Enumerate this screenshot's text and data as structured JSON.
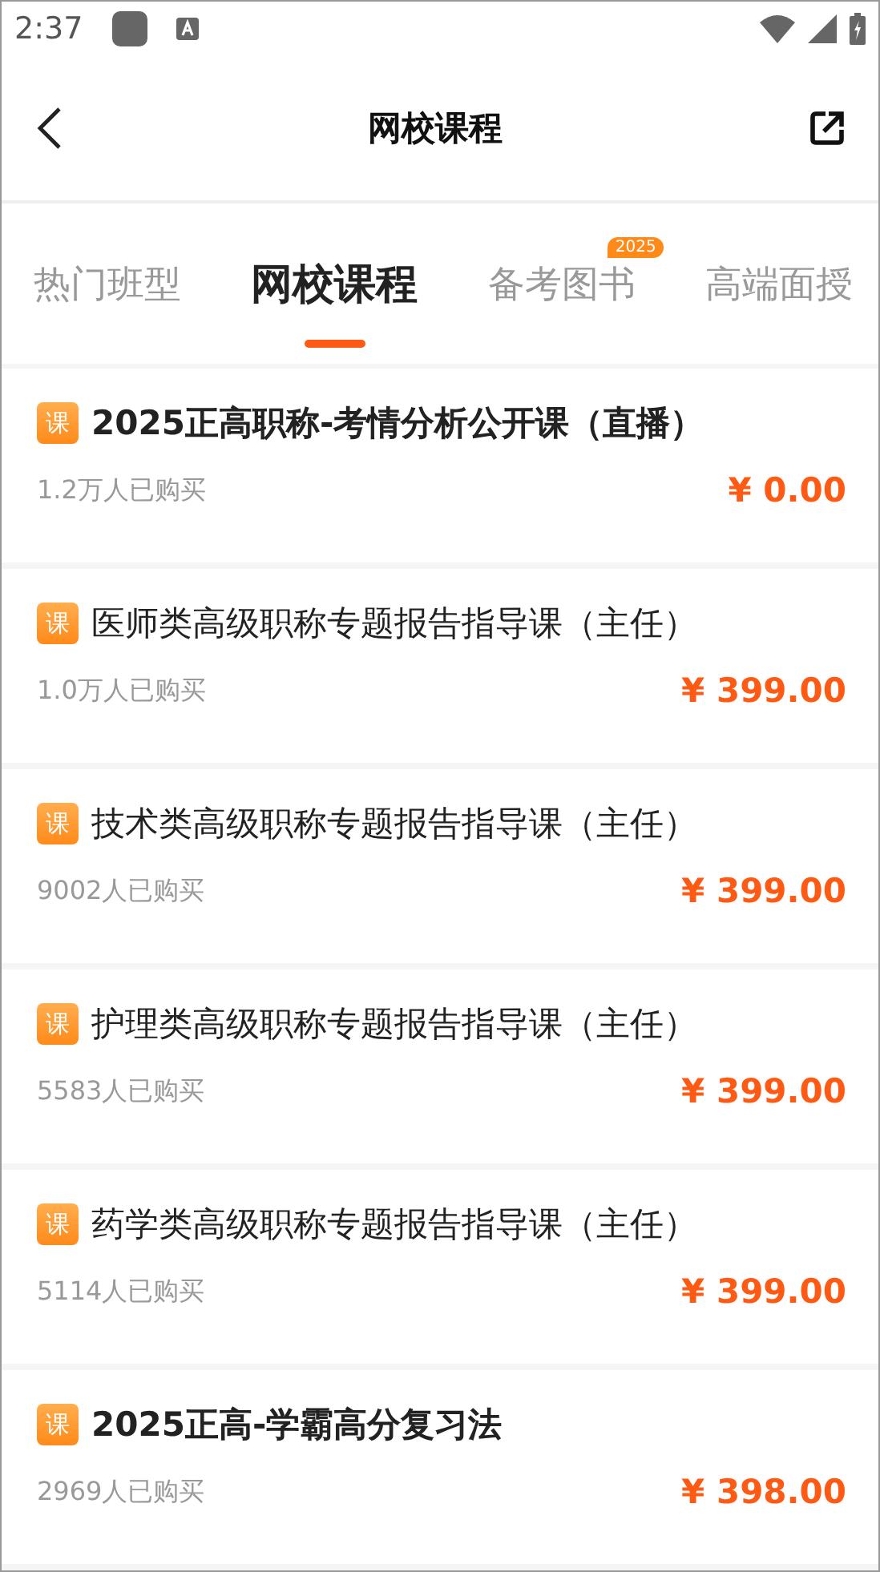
{
  "status_bar": {
    "time": "2:37"
  },
  "header": {
    "title": "网校课程"
  },
  "tabs": [
    {
      "label": "热门班型",
      "selected": false
    },
    {
      "label": "网校课程",
      "selected": true
    },
    {
      "label": "备考图书",
      "selected": false,
      "badge": "2025"
    },
    {
      "label": "高端面授",
      "selected": false
    }
  ],
  "courses": [
    {
      "tag": "课",
      "title": "2025正高职称-考情分析公开课（直播）",
      "bold": true,
      "buyers": "1.2万人已购买",
      "price": "¥ 0.00"
    },
    {
      "tag": "课",
      "title": "医师类高级职称专题报告指导课（主任）",
      "bold": false,
      "buyers": "1.0万人已购买",
      "price": "¥ 399.00"
    },
    {
      "tag": "课",
      "title": "技术类高级职称专题报告指导课（主任）",
      "bold": false,
      "buyers": "9002人已购买",
      "price": "¥ 399.00"
    },
    {
      "tag": "课",
      "title": "护理类高级职称专题报告指导课（主任）",
      "bold": false,
      "buyers": "5583人已购买",
      "price": "¥ 399.00"
    },
    {
      "tag": "课",
      "title": "药学类高级职称专题报告指导课（主任）",
      "bold": false,
      "buyers": "5114人已购买",
      "price": "¥ 399.00"
    },
    {
      "tag": "课",
      "title": "2025正高-学霸高分复习法",
      "bold": true,
      "buyers": "2969人已购买",
      "price": "¥ 398.00"
    }
  ]
}
